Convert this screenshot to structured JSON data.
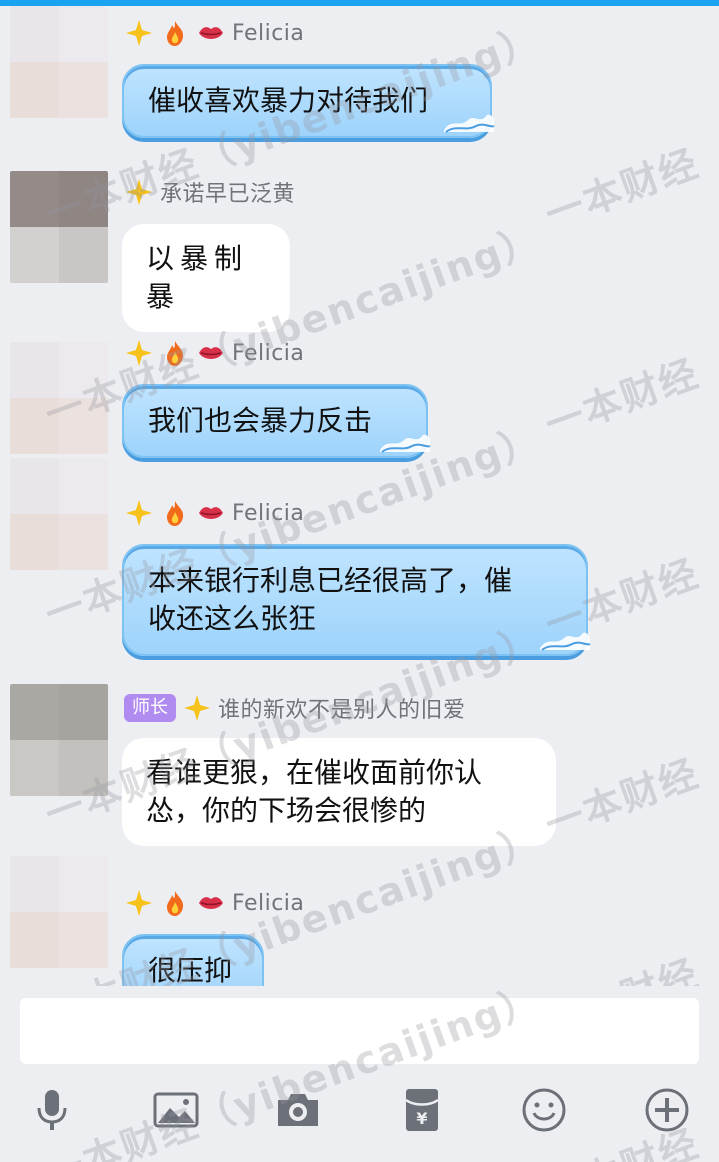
{
  "messages": [
    {
      "sender": "Felicia",
      "badges": [
        "star-badge",
        "fire-badge",
        "lips-badge"
      ],
      "text": [
        "催收喜欢暴力对待我们"
      ],
      "bubble": "blue"
    },
    {
      "sender": "承诺早已泛黄",
      "badges": [
        "star-badge"
      ],
      "text": [
        "以暴制暴"
      ],
      "bubble": "white-handwritten"
    },
    {
      "sender": "Felicia",
      "badges": [
        "star-badge",
        "fire-badge",
        "lips-badge"
      ],
      "text": [
        "我们也会暴力反击"
      ],
      "bubble": "blue"
    },
    {
      "sender": "Felicia",
      "badges": [
        "star-badge",
        "fire-badge",
        "lips-badge"
      ],
      "text": [
        "本来银行利息已经很高了，催",
        "收还这么张狂"
      ],
      "bubble": "blue"
    },
    {
      "sender": "谁的新欢不是别人的旧爱",
      "title_tag": "师长",
      "badges": [
        "star-badge"
      ],
      "text": [
        "看谁更狠，在催收面前你认",
        "怂，你的下场会很惨的"
      ],
      "bubble": "white"
    },
    {
      "sender": "Felicia",
      "badges": [
        "star-badge",
        "fire-badge",
        "lips-badge"
      ],
      "text": [
        "很压抑"
      ],
      "bubble": "blue"
    }
  ],
  "input": {
    "value": ""
  },
  "toolbar": [
    "microphone-icon",
    "image-icon",
    "camera-icon",
    "red-packet-icon",
    "emoji-icon",
    "plus-icon"
  ],
  "watermark": "一本财经（yibencaijing）",
  "colors": {
    "accent": "#1aa3ee",
    "bubble_blue": "#aedbfd",
    "background": "#eceef2",
    "title_tag": "#b08cf0"
  }
}
